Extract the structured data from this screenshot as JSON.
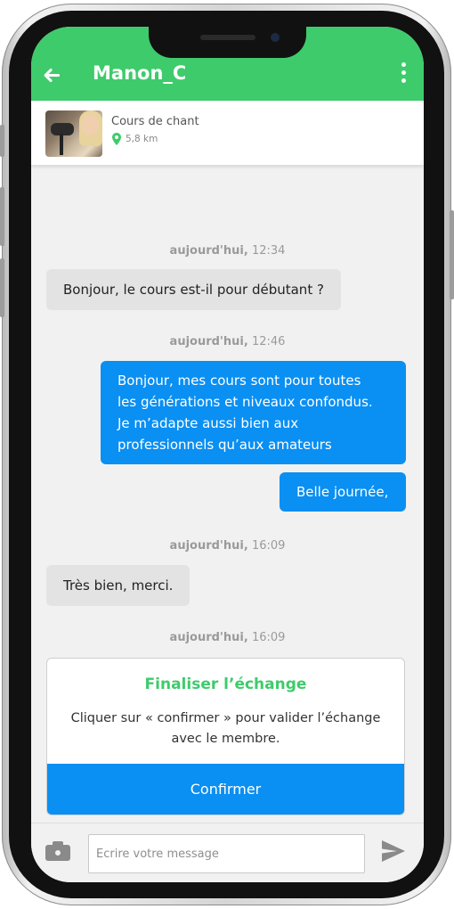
{
  "header": {
    "title": "Manon_C",
    "back_icon": "arrow-left-icon",
    "menu_icon": "more-vertical-icon",
    "color": "#3ecb6b"
  },
  "listing": {
    "title": "Cours de chant",
    "distance": "5,8 km",
    "location_icon": "map-pin-icon"
  },
  "messages": [
    {
      "type": "timestamp",
      "day": "aujourd'hui,",
      "time": "12:34"
    },
    {
      "type": "incoming",
      "text": "Bonjour, le cours est-il pour débutant ?"
    },
    {
      "type": "timestamp",
      "day": "aujourd'hui,",
      "time": "12:46"
    },
    {
      "type": "outgoing",
      "text": "Bonjour, mes cours sont pour toutes\nles générations et niveaux confondus.\nJe m’adapte aussi bien aux\nprofessionnels qu’aux amateurs"
    },
    {
      "type": "outgoing",
      "text": "Belle journée,"
    },
    {
      "type": "timestamp",
      "day": "aujourd'hui,",
      "time": "16:09"
    },
    {
      "type": "incoming",
      "text": "Très bien, merci."
    },
    {
      "type": "timestamp",
      "day": "aujourd'hui,",
      "time": "16:09"
    }
  ],
  "finalize": {
    "title": "Finaliser l’échange",
    "description": "Cliquer sur « confirmer » pour valider l’échange avec le membre.",
    "confirm_label": "Confirmer"
  },
  "composer": {
    "placeholder": "Ecrire votre message",
    "value": "",
    "camera_icon": "camera-icon",
    "send_icon": "send-icon"
  },
  "colors": {
    "accent_green": "#3ecb6b",
    "accent_blue": "#0a8ff2",
    "incoming_bubble": "#e3e3e3"
  }
}
